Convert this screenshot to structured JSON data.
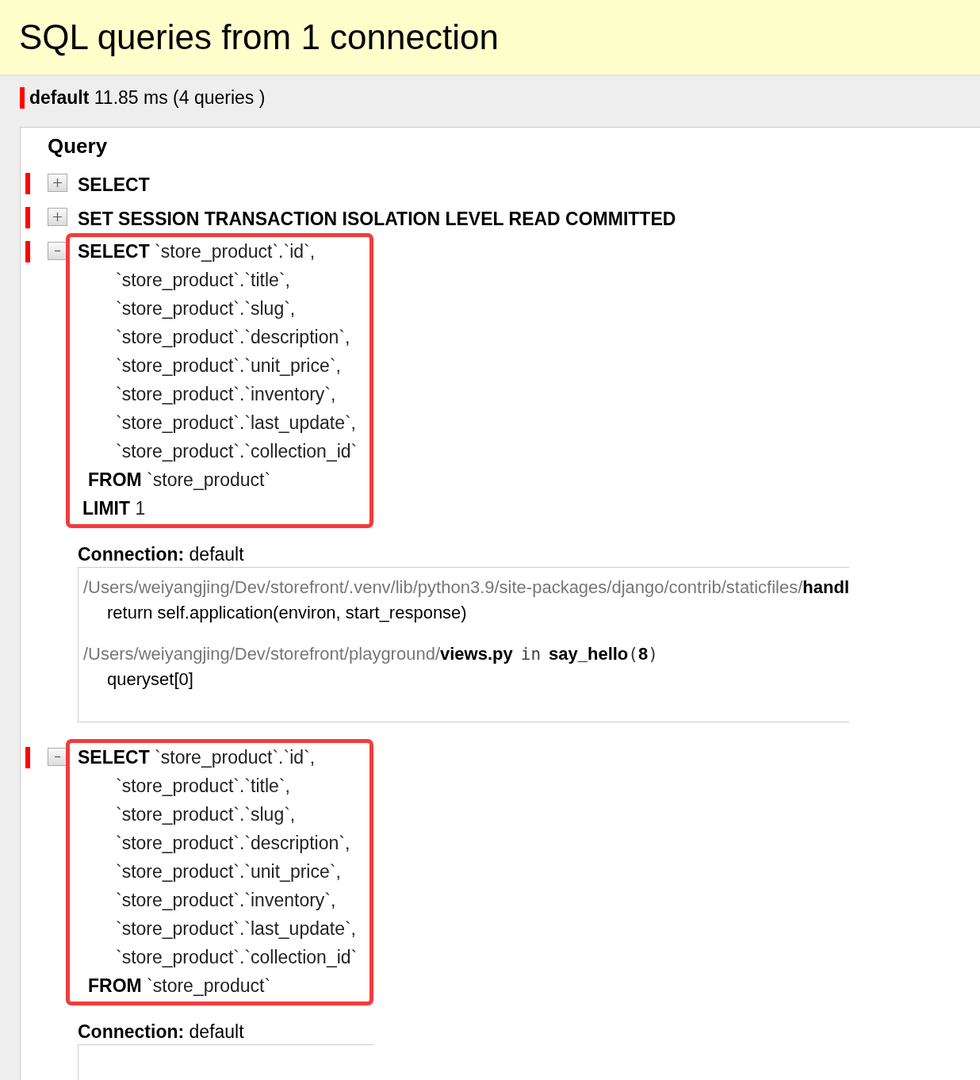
{
  "title": "SQL queries from 1 connection",
  "summary": {
    "alias": "default",
    "text": "11.85 ms (4 queries )"
  },
  "panel": {
    "heading": "Query",
    "queries": [
      {
        "expanded": false,
        "highlighted": false,
        "lines": [
          {
            "kind": "select",
            "text": "**SELECT**"
          }
        ]
      },
      {
        "expanded": false,
        "highlighted": false,
        "lines": [
          {
            "kind": "select",
            "text": "**SET SESSION TRANSACTION ISOLATION LEVEL READ COMMITTED**"
          }
        ]
      },
      {
        "expanded": true,
        "highlighted": true,
        "lines": [
          {
            "kind": "select",
            "text": "**SELECT** `store_product`.`id`,"
          },
          {
            "kind": "column",
            "text": "`store_product`.`title`,"
          },
          {
            "kind": "column",
            "text": "`store_product`.`slug`,"
          },
          {
            "kind": "column",
            "text": "`store_product`.`description`,"
          },
          {
            "kind": "column",
            "text": "`store_product`.`unit_price`,"
          },
          {
            "kind": "column",
            "text": "`store_product`.`inventory`,"
          },
          {
            "kind": "column",
            "text": "`store_product`.`last_update`,"
          },
          {
            "kind": "column",
            "text": "`store_product`.`collection_id`"
          },
          {
            "kind": "from",
            "text": "**FROM** `store_product`"
          },
          {
            "kind": "limit",
            "text": "**LIMIT** 1"
          }
        ],
        "connection": {
          "label": "Connection:",
          "value": "default",
          "stacktrace": [
            {
              "location": "/Users/weiyangjing/Dev/storefront/.venv/lib/python3.9/site-packages/django/contrib/staticfiles/**handl**",
              "code": "return self.application(environ, start_response)"
            },
            {
              "location": "/Users/weiyangjing/Dev/storefront/playground/**views.py**",
              "where": "in",
              "call": "**say_hello**(**8**)",
              "code": "queryset[0]"
            }
          ]
        }
      },
      {
        "expanded": true,
        "highlighted": true,
        "lines": [
          {
            "kind": "select",
            "text": "**SELECT** `store_product`.`id`,"
          },
          {
            "kind": "column",
            "text": "`store_product`.`title`,"
          },
          {
            "kind": "column",
            "text": "`store_product`.`slug`,"
          },
          {
            "kind": "column",
            "text": "`store_product`.`description`,"
          },
          {
            "kind": "column",
            "text": "`store_product`.`unit_price`,"
          },
          {
            "kind": "column",
            "text": "`store_product`.`inventory`,"
          },
          {
            "kind": "column",
            "text": "`store_product`.`last_update`,"
          },
          {
            "kind": "column",
            "text": "`store_product`.`collection_id`"
          },
          {
            "kind": "from",
            "text": "**FROM** `store_product`"
          }
        ],
        "connection": {
          "label": "Connection:",
          "value": "default"
        }
      }
    ]
  }
}
